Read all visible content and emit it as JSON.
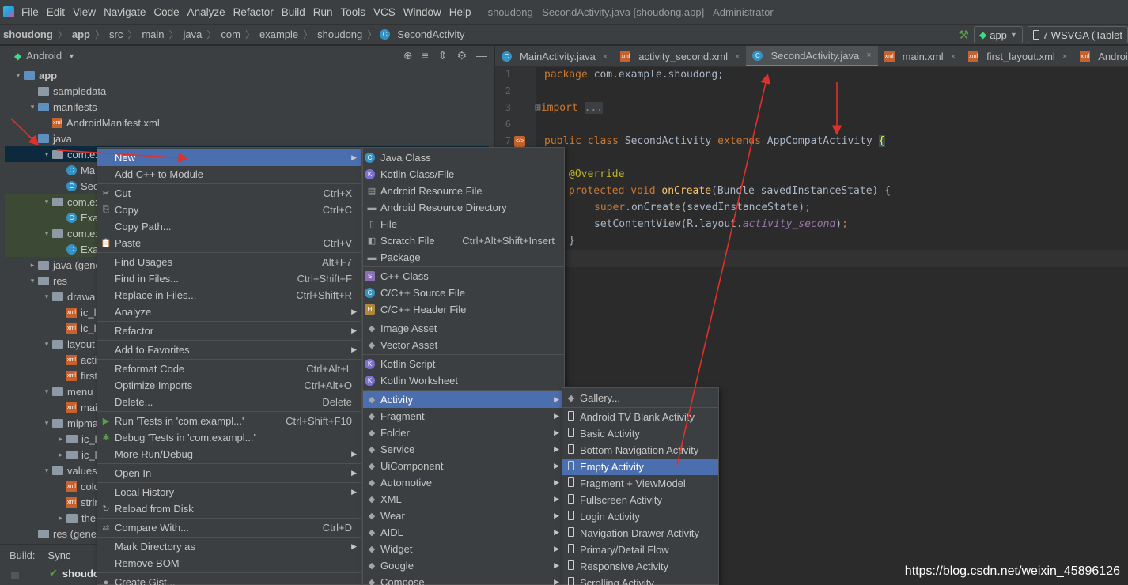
{
  "menubar": {
    "items": [
      "File",
      "Edit",
      "View",
      "Navigate",
      "Code",
      "Analyze",
      "Refactor",
      "Build",
      "Run",
      "Tools",
      "VCS",
      "Window",
      "Help"
    ],
    "window_title": "shoudong - SecondActivity.java [shoudong.app] - Administrator"
  },
  "breadcrumb": {
    "items": [
      "shoudong",
      "app",
      "src",
      "main",
      "java",
      "com",
      "example",
      "shoudong",
      "SecondActivity"
    ]
  },
  "run": {
    "config": "app",
    "device": "7  WSVGA (Tablet"
  },
  "project": {
    "view": "Android",
    "tree": [
      {
        "label": "app",
        "indent": 0,
        "arrow": "▾",
        "icon": "folder-blue"
      },
      {
        "label": "sampledata",
        "indent": 1,
        "arrow": "",
        "icon": "folder"
      },
      {
        "label": "manifests",
        "indent": 1,
        "arrow": "▾",
        "icon": "folder-blue"
      },
      {
        "label": "AndroidManifest.xml",
        "indent": 2,
        "arrow": "",
        "icon": "xml"
      },
      {
        "label": "java",
        "indent": 1,
        "arrow": "▾",
        "icon": "folder-blue"
      },
      {
        "label": "com.ex",
        "indent": 2,
        "arrow": "▾",
        "icon": "folder",
        "sel": true
      },
      {
        "label": "Ma",
        "indent": 3,
        "arrow": "",
        "icon": "class"
      },
      {
        "label": "Sec",
        "indent": 3,
        "arrow": "",
        "icon": "class"
      },
      {
        "label": "com.ex",
        "indent": 2,
        "arrow": "▾",
        "icon": "folder",
        "grn": true
      },
      {
        "label": "Exa",
        "indent": 3,
        "arrow": "",
        "icon": "class",
        "grn": true
      },
      {
        "label": "com.ex",
        "indent": 2,
        "arrow": "▾",
        "icon": "folder",
        "grn": true
      },
      {
        "label": "Exa",
        "indent": 3,
        "arrow": "",
        "icon": "class",
        "grn": true
      },
      {
        "label": "java (gene",
        "indent": 1,
        "arrow": "▸",
        "icon": "folder"
      },
      {
        "label": "res",
        "indent": 1,
        "arrow": "▾",
        "icon": "folder"
      },
      {
        "label": "drawa",
        "indent": 2,
        "arrow": "▾",
        "icon": "folder"
      },
      {
        "label": "ic_la",
        "indent": 3,
        "arrow": "",
        "icon": "xml"
      },
      {
        "label": "ic_la",
        "indent": 3,
        "arrow": "",
        "icon": "xml"
      },
      {
        "label": "layout",
        "indent": 2,
        "arrow": "▾",
        "icon": "folder"
      },
      {
        "label": "acti",
        "indent": 3,
        "arrow": "",
        "icon": "xml"
      },
      {
        "label": "first",
        "indent": 3,
        "arrow": "",
        "icon": "xml"
      },
      {
        "label": "menu",
        "indent": 2,
        "arrow": "▾",
        "icon": "folder"
      },
      {
        "label": "mai",
        "indent": 3,
        "arrow": "",
        "icon": "xml"
      },
      {
        "label": "mipma",
        "indent": 2,
        "arrow": "▾",
        "icon": "folder"
      },
      {
        "label": "ic_la",
        "indent": 3,
        "arrow": "▸",
        "icon": "folder"
      },
      {
        "label": "ic_la",
        "indent": 3,
        "arrow": "▸",
        "icon": "folder"
      },
      {
        "label": "values",
        "indent": 2,
        "arrow": "▾",
        "icon": "folder"
      },
      {
        "label": "colo",
        "indent": 3,
        "arrow": "",
        "icon": "xml"
      },
      {
        "label": "strin",
        "indent": 3,
        "arrow": "",
        "icon": "xml"
      },
      {
        "label": "the",
        "indent": 3,
        "arrow": "▸",
        "icon": "folder"
      },
      {
        "label": "res (gene",
        "indent": 1,
        "arrow": "",
        "icon": "folder"
      }
    ]
  },
  "build": {
    "label": "Build:",
    "tab": "Sync",
    "item": "shoudo"
  },
  "tabs": [
    "MainActivity.java",
    "activity_second.xml",
    "SecondActivity.java",
    "main.xml",
    "first_layout.xml",
    "AndroidMan"
  ],
  "editor": {
    "line_numbers": [
      "1",
      "2",
      "3",
      "6",
      "7",
      "",
      "",
      "",
      "",
      "",
      ""
    ]
  },
  "context_menu": {
    "items": [
      {
        "label": "New",
        "shortcut": "",
        "sub": true,
        "hl": true,
        "icon": ""
      },
      {
        "label": "Add C++ to Module",
        "shortcut": "",
        "sub": false,
        "icon": ""
      },
      {
        "sep": true
      },
      {
        "label": "Cut",
        "shortcut": "Ctrl+X",
        "icon": "✂"
      },
      {
        "label": "Copy",
        "shortcut": "Ctrl+C",
        "icon": "⎘"
      },
      {
        "label": "Copy Path...",
        "shortcut": "",
        "icon": ""
      },
      {
        "label": "Paste",
        "shortcut": "Ctrl+V",
        "icon": "📋"
      },
      {
        "sep": true
      },
      {
        "label": "Find Usages",
        "shortcut": "Alt+F7",
        "icon": ""
      },
      {
        "label": "Find in Files...",
        "shortcut": "Ctrl+Shift+F",
        "icon": ""
      },
      {
        "label": "Replace in Files...",
        "shortcut": "Ctrl+Shift+R",
        "icon": ""
      },
      {
        "label": "Analyze",
        "shortcut": "",
        "sub": true,
        "icon": ""
      },
      {
        "sep": true
      },
      {
        "label": "Refactor",
        "shortcut": "",
        "sub": true,
        "icon": ""
      },
      {
        "sep": true
      },
      {
        "label": "Add to Favorites",
        "shortcut": "",
        "sub": true,
        "icon": ""
      },
      {
        "sep": true
      },
      {
        "label": "Reformat Code",
        "shortcut": "Ctrl+Alt+L",
        "icon": ""
      },
      {
        "label": "Optimize Imports",
        "shortcut": "Ctrl+Alt+O",
        "icon": ""
      },
      {
        "label": "Delete...",
        "shortcut": "Delete",
        "icon": ""
      },
      {
        "sep": true
      },
      {
        "label": "Run 'Tests in 'com.exampl...'",
        "shortcut": "Ctrl+Shift+F10",
        "icon": "▶"
      },
      {
        "label": "Debug 'Tests in 'com.exampl...'",
        "shortcut": "",
        "icon": "✱"
      },
      {
        "label": "More Run/Debug",
        "shortcut": "",
        "sub": true,
        "icon": ""
      },
      {
        "sep": true
      },
      {
        "label": "Open In",
        "shortcut": "",
        "sub": true,
        "icon": ""
      },
      {
        "sep": true
      },
      {
        "label": "Local History",
        "shortcut": "",
        "sub": true,
        "icon": ""
      },
      {
        "label": "Reload from Disk",
        "shortcut": "",
        "icon": "↻"
      },
      {
        "sep": true
      },
      {
        "label": "Compare With...",
        "shortcut": "Ctrl+D",
        "icon": "⇄"
      },
      {
        "sep": true
      },
      {
        "label": "Mark Directory as",
        "shortcut": "",
        "sub": true,
        "icon": ""
      },
      {
        "label": "Remove BOM",
        "shortcut": "",
        "icon": ""
      },
      {
        "sep": true
      },
      {
        "label": "Create Gist...",
        "shortcut": "",
        "icon": "●"
      }
    ]
  },
  "new_menu": {
    "items": [
      {
        "label": "Java Class",
        "icon": "C",
        "shortcut": ""
      },
      {
        "label": "Kotlin Class/File",
        "icon": "K",
        "shortcut": ""
      },
      {
        "label": "Android Resource File",
        "icon": "▤",
        "shortcut": ""
      },
      {
        "label": "Android Resource Directory",
        "icon": "▬",
        "shortcut": ""
      },
      {
        "label": "File",
        "icon": "▯",
        "shortcut": ""
      },
      {
        "label": "Scratch File",
        "icon": "◧",
        "shortcut": "Ctrl+Alt+Shift+Insert"
      },
      {
        "label": "Package",
        "icon": "▬",
        "shortcut": ""
      },
      {
        "sep": true
      },
      {
        "label": "C++ Class",
        "icon": "S",
        "shortcut": ""
      },
      {
        "label": "C/C++ Source File",
        "icon": "C",
        "shortcut": ""
      },
      {
        "label": "C/C++ Header File",
        "icon": "H",
        "shortcut": ""
      },
      {
        "sep": true
      },
      {
        "label": "Image Asset",
        "icon": "andr",
        "shortcut": ""
      },
      {
        "label": "Vector Asset",
        "icon": "andr",
        "shortcut": ""
      },
      {
        "sep": true
      },
      {
        "label": "Kotlin Script",
        "icon": "K",
        "shortcut": ""
      },
      {
        "label": "Kotlin Worksheet",
        "icon": "K",
        "shortcut": ""
      },
      {
        "sep": true
      },
      {
        "label": "Activity",
        "icon": "andr",
        "sub": true,
        "hl": true
      },
      {
        "label": "Fragment",
        "icon": "andr",
        "sub": true
      },
      {
        "label": "Folder",
        "icon": "andr",
        "sub": true
      },
      {
        "label": "Service",
        "icon": "andr",
        "sub": true
      },
      {
        "label": "UiComponent",
        "icon": "andr",
        "sub": true
      },
      {
        "label": "Automotive",
        "icon": "andr",
        "sub": true
      },
      {
        "label": "XML",
        "icon": "andr",
        "sub": true
      },
      {
        "label": "Wear",
        "icon": "andr",
        "sub": true
      },
      {
        "label": "AIDL",
        "icon": "andr",
        "sub": true
      },
      {
        "label": "Widget",
        "icon": "andr",
        "sub": true
      },
      {
        "label": "Google",
        "icon": "andr",
        "sub": true
      },
      {
        "label": "Compose",
        "icon": "andr",
        "sub": true
      }
    ]
  },
  "activity_menu": {
    "items": [
      {
        "label": "Gallery...",
        "icon": "andr"
      },
      {
        "sep": true
      },
      {
        "label": "Android TV Blank Activity",
        "icon": "phone"
      },
      {
        "label": "Basic Activity",
        "icon": "phone"
      },
      {
        "label": "Bottom Navigation Activity",
        "icon": "phone"
      },
      {
        "label": "Empty Activity",
        "icon": "phone",
        "hl": true
      },
      {
        "label": "Fragment + ViewModel",
        "icon": "phone"
      },
      {
        "label": "Fullscreen Activity",
        "icon": "phone"
      },
      {
        "label": "Login Activity",
        "icon": "phone"
      },
      {
        "label": "Navigation Drawer Activity",
        "icon": "phone"
      },
      {
        "label": "Primary/Detail Flow",
        "icon": "phone"
      },
      {
        "label": "Responsive Activity",
        "icon": "phone"
      },
      {
        "label": "Scrolling Activity",
        "icon": "phone"
      }
    ]
  },
  "watermark": "https://blog.csdn.net/weixin_45896126",
  "colors": {
    "highlight": "#4b6eaf",
    "annotation_arrow": "#e0302a",
    "android_green": "#3ddc84"
  }
}
